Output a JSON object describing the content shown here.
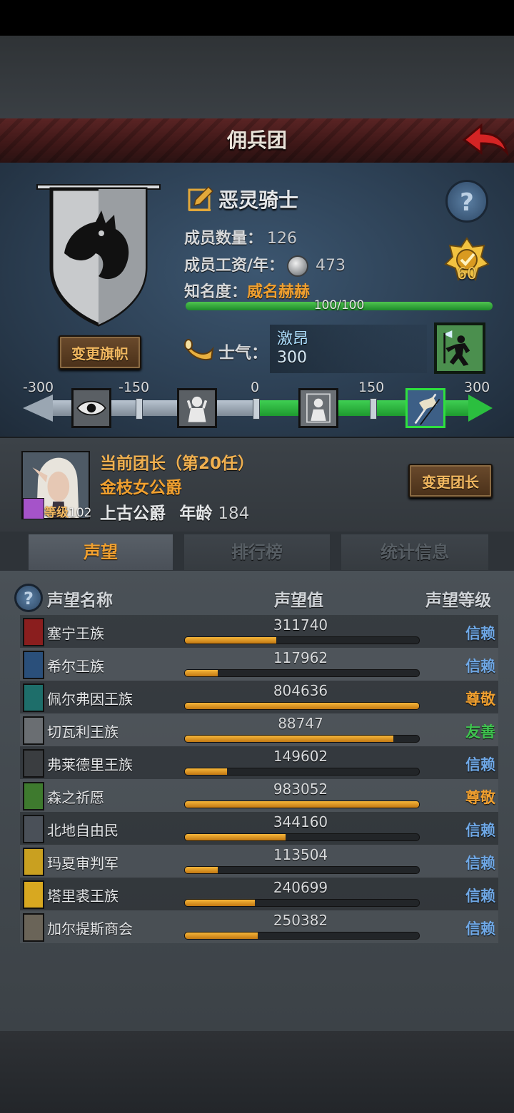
{
  "title": "佣兵团",
  "guild": {
    "name": "恶灵骑士",
    "members_label": "成员数量：",
    "members_value": "126",
    "salary_label": "成员工资/年：",
    "salary_value": "473",
    "fame_label": "知名度：",
    "fame_value": "威名赫赫",
    "fame_progress_text": "100/100",
    "fame_progress": 1.0,
    "badge_number": "60",
    "change_flag_label": "变更旗帜"
  },
  "morale": {
    "label": "士气：",
    "state": "激昂",
    "value": "300",
    "scale_ticks": [
      "-300",
      "-150",
      "0",
      "150",
      "300"
    ]
  },
  "leader": {
    "title": "当前团长（第20任）",
    "name": "金枝女公爵",
    "level_label": "等级",
    "level_value": "102",
    "rank": "上古公爵",
    "age_label": "年龄",
    "age_value": "184",
    "change_label": "变更团长"
  },
  "tabs": [
    "声望",
    "排行榜",
    "统计信息"
  ],
  "reputation": {
    "headers": {
      "name": "声望名称",
      "value": "声望值",
      "level": "声望等级"
    },
    "rows": [
      {
        "name": "塞宁王族",
        "value": "311740",
        "progress": 0.39,
        "level": "信赖",
        "level_color": "#6fa8e6",
        "icon_color": "#8a1e1e"
      },
      {
        "name": "希尔王族",
        "value": "117962",
        "progress": 0.14,
        "level": "信赖",
        "level_color": "#6fa8e6",
        "icon_color": "#2a4f7a"
      },
      {
        "name": "佩尔弗因王族",
        "value": "804636",
        "progress": 1.0,
        "level": "尊敬",
        "level_color": "#f0a030",
        "icon_color": "#1e6e6a"
      },
      {
        "name": "切瓦利王族",
        "value": "88747",
        "progress": 0.89,
        "level": "友善",
        "level_color": "#3fc44f",
        "icon_color": "#6a6e72"
      },
      {
        "name": "弗莱德里王族",
        "value": "149602",
        "progress": 0.18,
        "level": "信赖",
        "level_color": "#6fa8e6",
        "icon_color": "#3a3d40"
      },
      {
        "name": "森之祈愿",
        "value": "983052",
        "progress": 1.0,
        "level": "尊敬",
        "level_color": "#f0a030",
        "icon_color": "#3e7a2e"
      },
      {
        "name": "北地自由民",
        "value": "344160",
        "progress": 0.43,
        "level": "信赖",
        "level_color": "#6fa8e6",
        "icon_color": "#4a5058"
      },
      {
        "name": "玛夏审判军",
        "value": "113504",
        "progress": 0.14,
        "level": "信赖",
        "level_color": "#6fa8e6",
        "icon_color": "#c9a020"
      },
      {
        "name": "塔里裘王族",
        "value": "240699",
        "progress": 0.3,
        "level": "信赖",
        "level_color": "#6fa8e6",
        "icon_color": "#d8a820"
      },
      {
        "name": "加尔提斯商会",
        "value": "250382",
        "progress": 0.31,
        "level": "信赖",
        "level_color": "#6fa8e6",
        "icon_color": "#6a6458"
      }
    ]
  }
}
